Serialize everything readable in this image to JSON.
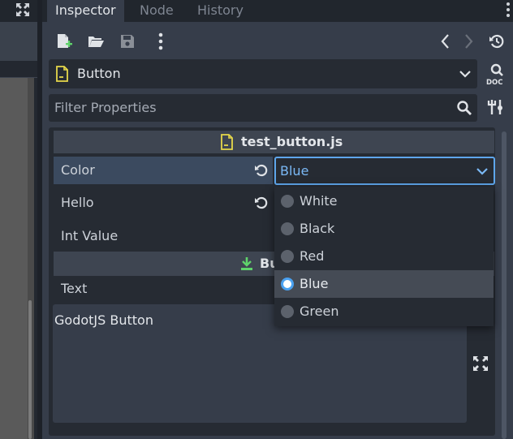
{
  "tabs": [
    {
      "label": "Inspector",
      "active": true
    },
    {
      "label": "Node",
      "active": false
    },
    {
      "label": "History",
      "active": false
    }
  ],
  "node_selector": {
    "label": "Button"
  },
  "filter": {
    "placeholder": "Filter Properties"
  },
  "script_section": {
    "title": "test_button.js"
  },
  "properties": [
    {
      "label": "Color",
      "value": "Blue"
    },
    {
      "label": "Hello"
    },
    {
      "label": "Int Value"
    }
  ],
  "class_section": {
    "title_visible": "Bu"
  },
  "text_property": {
    "label": "Text",
    "value": "GodotJS Button"
  },
  "dropdown_options": [
    {
      "label": "White",
      "selected": false
    },
    {
      "label": "Black",
      "selected": false
    },
    {
      "label": "Red",
      "selected": false
    },
    {
      "label": "Blue",
      "selected": true
    },
    {
      "label": "Green",
      "selected": false
    }
  ],
  "colors": {
    "accent": "#5ea6ec",
    "panel_bg": "#262b33",
    "dock_bg": "#363d4a"
  }
}
